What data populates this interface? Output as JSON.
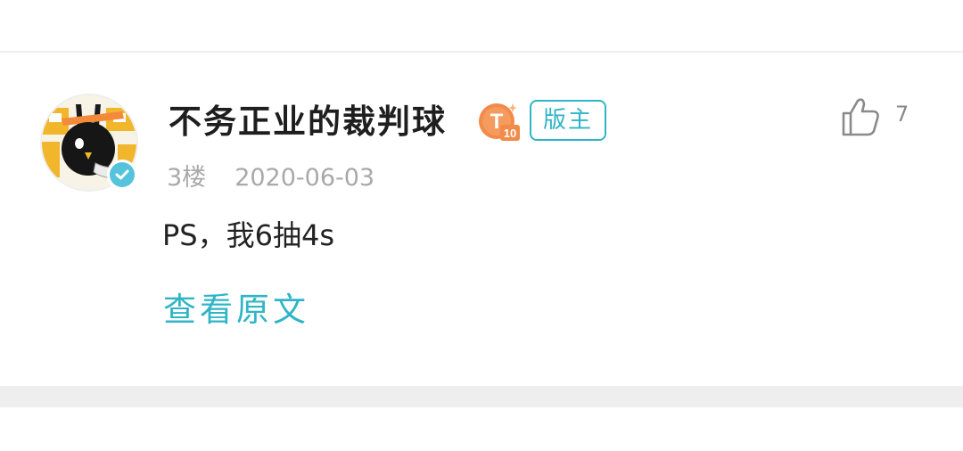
{
  "post": {
    "username": "不务正业的裁判球",
    "level_badge": {
      "letter": "T",
      "level": "10",
      "color": "#f28a4a"
    },
    "mod_badge": "版主",
    "floor": "3楼",
    "date": "2020-06-03",
    "content": "PS，我6抽4s",
    "view_original": "查看原文",
    "like_count": "7"
  },
  "colors": {
    "accent": "#2fb5c6",
    "meta_gray": "#a9a9a9",
    "divider": "#eeeeee"
  },
  "icons": {
    "avatar": "cartoon-bird-avatar",
    "verified": "verified-check-icon",
    "like": "thumbs-up-icon"
  }
}
